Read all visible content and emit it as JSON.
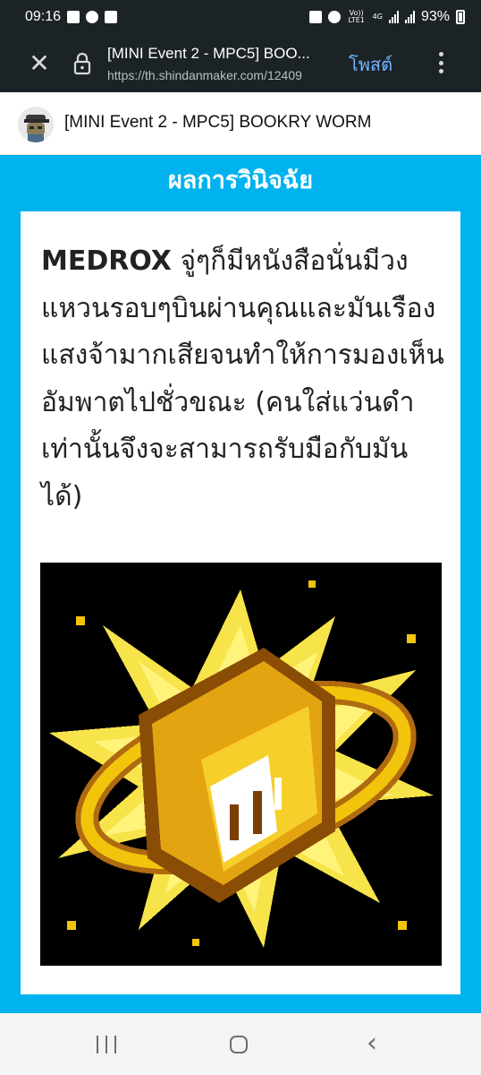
{
  "status_bar": {
    "time": "09:16",
    "network_label": "4G",
    "volte_label": "Vo)) LTE1",
    "battery": "93%",
    "left_icons": [
      "image-icon",
      "do-not-disturb-icon",
      "download-check-icon"
    ],
    "right_icons": [
      "battery-saver-icon",
      "alarm-icon",
      "volte-icon",
      "signal-icon",
      "signal-icon",
      "battery-icon"
    ]
  },
  "browser": {
    "page_title": "[MINI Event 2 - MPC5] BOO...",
    "url": "https://th.shindanmaker.com/12409",
    "post_label": "โพสต์"
  },
  "site_header": {
    "title": "[MINI Event 2 - MPC5] BOOKRY WORM"
  },
  "result": {
    "heading": "ผลการวินิจฉัย",
    "name": "MEDROX",
    "text": " จู่ๆก็มีหนังสือนั่นมีวงแหวนรอบๆบินผ่านคุณและมันเรืองแสงจ้ามากเสียจนทำให้การมองเห็นอัมพาตไปชั่วขณะ (คนใส่แว่นดำเท่านั้นจึงจะสามารถรับมือกับมันได้)",
    "image_icon": "glowing-golden-book-icon"
  },
  "colors": {
    "chrome_dark": "#1c2326",
    "accent_blue": "#00b3ee",
    "post_blue": "#6fb4ff",
    "gold": "#f2c40c"
  },
  "nav_bar": {
    "icons": [
      "recent-apps-icon",
      "home-icon",
      "back-icon"
    ]
  }
}
